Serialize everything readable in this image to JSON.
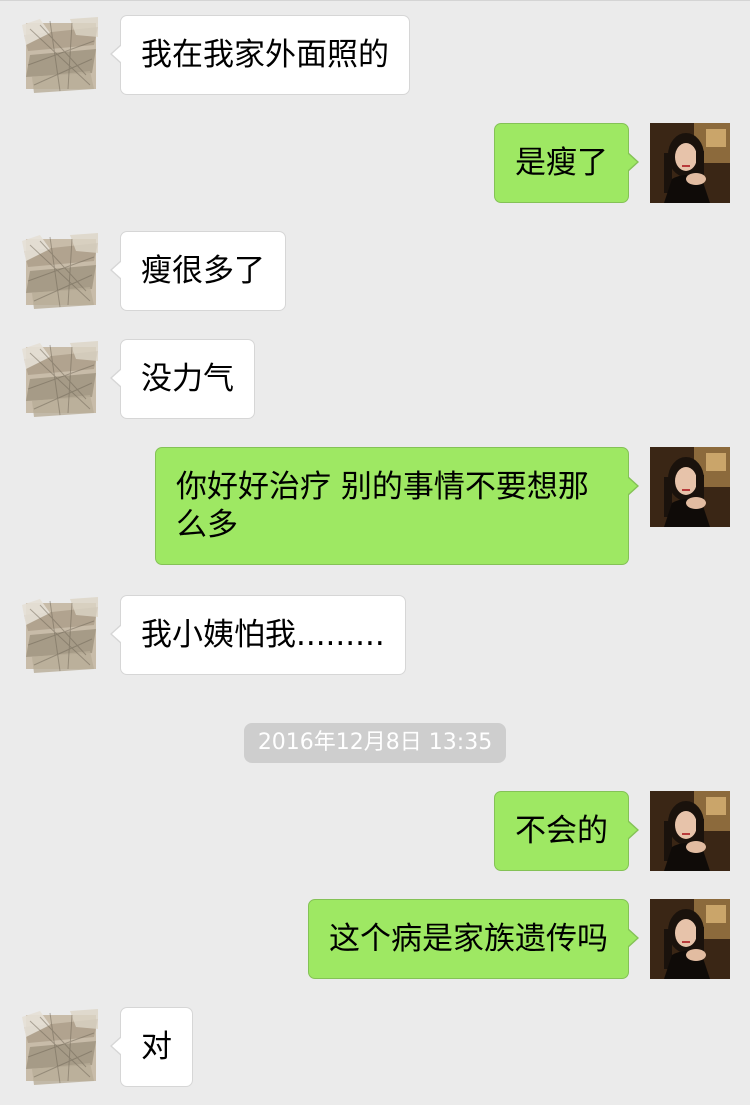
{
  "chat": {
    "timestamp": "2016年12月8日 13:35",
    "messages": [
      {
        "side": "in",
        "text": "我在我家外面照的"
      },
      {
        "side": "out",
        "text": "是瘦了"
      },
      {
        "side": "in",
        "text": "瘦很多了"
      },
      {
        "side": "in",
        "text": "没力气"
      },
      {
        "side": "out",
        "text": "你好好治疗 别的事情不要想那么多"
      },
      {
        "side": "in",
        "text": "我小姨怕我........."
      },
      {
        "side": "out",
        "text": "不会的"
      },
      {
        "side": "out",
        "text": "这个病是家族遗传吗"
      },
      {
        "side": "in",
        "text": "对"
      }
    ]
  },
  "avatars": {
    "contact": "scribbled-contact-avatar",
    "self": "woman-portrait-avatar"
  },
  "colors": {
    "background": "#ebebeb",
    "incoming_bubble": "#ffffff",
    "outgoing_bubble": "#9ee863",
    "timestamp_pill": "#cecece"
  }
}
